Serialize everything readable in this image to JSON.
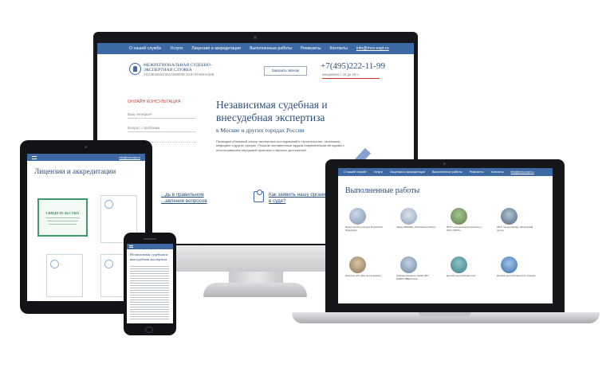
{
  "monitor_site": {
    "nav": [
      "О нашей службе",
      "Услуги",
      "Лицензии и аккредитации",
      "Выполненные работы",
      "Реквизиты",
      "Контакты",
      "info@mcs-expt.ru"
    ],
    "org_name_line1": "МЕЖРЕГИОНАЛЬНАЯ СУДЕБНО-",
    "org_name_line2": "ЭКСПЕРТНАЯ СЛУЖБА",
    "org_subtitle": "АВТОНОМНАЯ НЕКОММЕРЧЕСКАЯ ОРГАНИЗАЦИЯ",
    "callback_button": "Заказать звонок",
    "phone": "+7(495)222-11-99",
    "hours": "ежедневно с 10 до 19 ч.",
    "consult_title": "ОНЛАЙН КОНСУЛЬТАЦИЯ",
    "phone_placeholder": "Ваш телефон*",
    "question_placeholder": "Вопрос / проблема",
    "hero_title_line1": "Независимая судебная и",
    "hero_title_line2": "внесудебная экспертиза",
    "hero_subtitle": "в Москве и других городах России",
    "hero_body": "Проводим объемный спектр экспертных исследований в строительстве, экономике, медицине и других сферах. Решаем поставленные задачи современными методами с использованием передовой практики и научных достижений.",
    "link1_line1": "...дь в правильном",
    "link1_line2": "...авлении вопросов",
    "link2_line1": "Как заявить нашу органи...",
    "link2_line2": "в суде?"
  },
  "tablet_site": {
    "email": "info@mcs-expt.ru",
    "page_title": "Лицензии и аккредитации",
    "certificate_heading": "СВИДЕТЕЛЬСТВО"
  },
  "phone_site": {
    "heading_line1": "Независимая судебная и",
    "heading_line2": "внесудебная экспертиза"
  },
  "laptop_site": {
    "nav": [
      "О нашей службе",
      "Услуги",
      "Лицензии и аккредитации",
      "Выполненные работы",
      "Реквизиты",
      "Контакты",
      "info@mcs-expt.ru"
    ],
    "page_title": "Выполненные работы",
    "works": [
      {
        "title": "Министерство культуры Российской Федерации"
      },
      {
        "title": "Завод «ВИНОВ», Московская область"
      },
      {
        "title": "ФГУП «Специальный комплекс» с ОАО «ЭЗОП»"
      },
      {
        "title": "ГБОУ города Москвы «Московский центр»"
      },
      {
        "title": "Комплекс ЖК «Дом на Сухаревке»"
      },
      {
        "title": "Административное здание ФКУ ЦЭФЛС МВД России"
      },
      {
        "title": "Детский центр Москва-Сити"
      },
      {
        "title": "Детский центр Москва-Сити, Кунцево"
      }
    ]
  },
  "colors": {
    "nav_blue": "#3d6aa5",
    "accent_red": "#c0392b",
    "title_blue": "#2c4d7c",
    "cert_green": "#2e7d4f"
  }
}
